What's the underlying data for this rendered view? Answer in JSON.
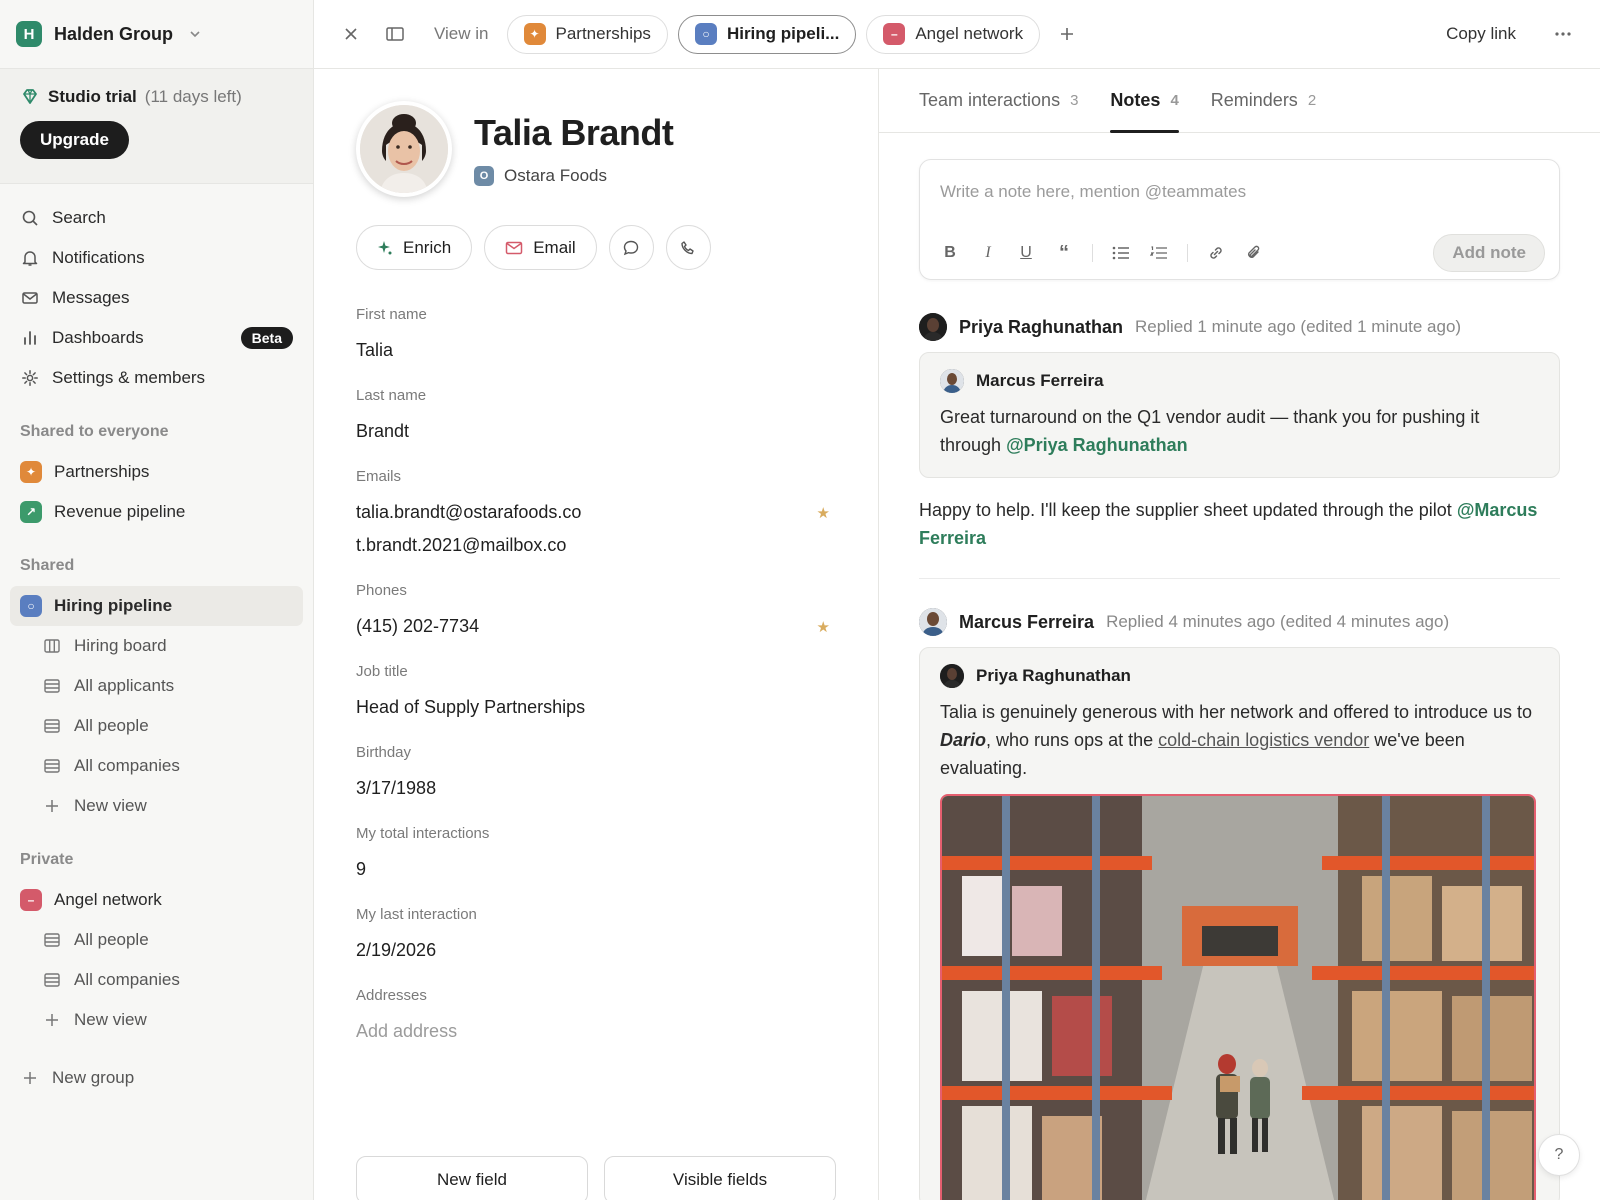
{
  "workspace": {
    "initial": "H",
    "name": "Halden Group"
  },
  "trial": {
    "title": "Studio trial",
    "days": "(11 days left)",
    "upgrade": "Upgrade"
  },
  "nav": [
    {
      "label": "Search",
      "icon": "search-icon"
    },
    {
      "label": "Notifications",
      "icon": "bell-icon"
    },
    {
      "label": "Messages",
      "icon": "mail-icon"
    },
    {
      "label": "Dashboards",
      "icon": "bar-chart-icon",
      "badge": "Beta"
    },
    {
      "label": "Settings & members",
      "icon": "gear-icon"
    }
  ],
  "sections": {
    "shared_everyone": "Shared to everyone",
    "shared": "Shared",
    "private": "Private"
  },
  "shared_everyone": [
    {
      "label": "Partnerships",
      "color": "#e0893a"
    },
    {
      "label": "Revenue pipeline",
      "color": "#3c9a6b"
    }
  ],
  "shared_list": {
    "label": "Hiring pipeline",
    "color": "#5a7ec0",
    "children": [
      "Hiring board",
      "All applicants",
      "All people",
      "All companies",
      "New view"
    ]
  },
  "private_list": {
    "label": "Angel network",
    "color": "#d45a6a",
    "children": [
      "All people",
      "All companies",
      "New view"
    ]
  },
  "new_group": "New group",
  "topbar": {
    "view_in": "View in",
    "tabs": [
      {
        "label": "Partnerships",
        "color": "#e0893a"
      },
      {
        "label": "Hiring pipeli...",
        "color": "#5a7ec0"
      },
      {
        "label": "Angel network",
        "color": "#d45a6a"
      }
    ],
    "copy_link": "Copy link"
  },
  "record": {
    "name": "Talia Brandt",
    "company_initial": "O",
    "company": "Ostara Foods",
    "actions": {
      "enrich": "Enrich",
      "email": "Email"
    },
    "fields": {
      "first_name": {
        "label": "First name",
        "value": "Talia"
      },
      "last_name": {
        "label": "Last name",
        "value": "Brandt"
      },
      "emails": {
        "label": "Emails",
        "values": [
          "talia.brandt@ostarafoods.co",
          "t.brandt.2021@mailbox.co"
        ]
      },
      "phones": {
        "label": "Phones",
        "value": "(415) 202-7734"
      },
      "job_title": {
        "label": "Job title",
        "value": "Head of Supply Partnerships"
      },
      "birthday": {
        "label": "Birthday",
        "value": "3/17/1988"
      },
      "interactions": {
        "label": "My total interactions",
        "value": "9"
      },
      "last_interaction": {
        "label": "My last interaction",
        "value": "2/19/2026"
      },
      "addresses": {
        "label": "Addresses",
        "placeholder": "Add address"
      }
    },
    "new_field": "New field",
    "visible_fields": "Visible fields"
  },
  "notes_panel": {
    "tabs": [
      {
        "label": "Team interactions",
        "count": "3"
      },
      {
        "label": "Notes",
        "count": "4"
      },
      {
        "label": "Reminders",
        "count": "2"
      }
    ],
    "composer_placeholder": "Write a note here, mention @teammates",
    "add_note": "Add note",
    "thread1": {
      "author": "Priya Raghunathan",
      "meta": "Replied 1 minute ago (edited 1 minute ago)",
      "quote_author": "Marcus Ferreira",
      "quote_text": "Great turnaround on the Q1 vendor audit — thank you for pushing it through",
      "quote_mention": "@Priya Raghunathan",
      "reply_text": "Happy to help. I'll keep the supplier sheet updated through the pilot",
      "reply_mention": "@Marcus Ferreira"
    },
    "thread2": {
      "author": "Marcus Ferreira",
      "meta": "Replied 4 minutes ago (edited 4 minutes ago)",
      "quote_author": "Priya Raghunathan",
      "text_before": "Talia is genuinely generous with her network and offered to introduce us to",
      "bold_name": "Dario",
      "text_mid": ", who runs ops at the",
      "link_text": "cold-chain logistics vendor",
      "text_after": "we've been evaluating."
    }
  },
  "help": "?"
}
